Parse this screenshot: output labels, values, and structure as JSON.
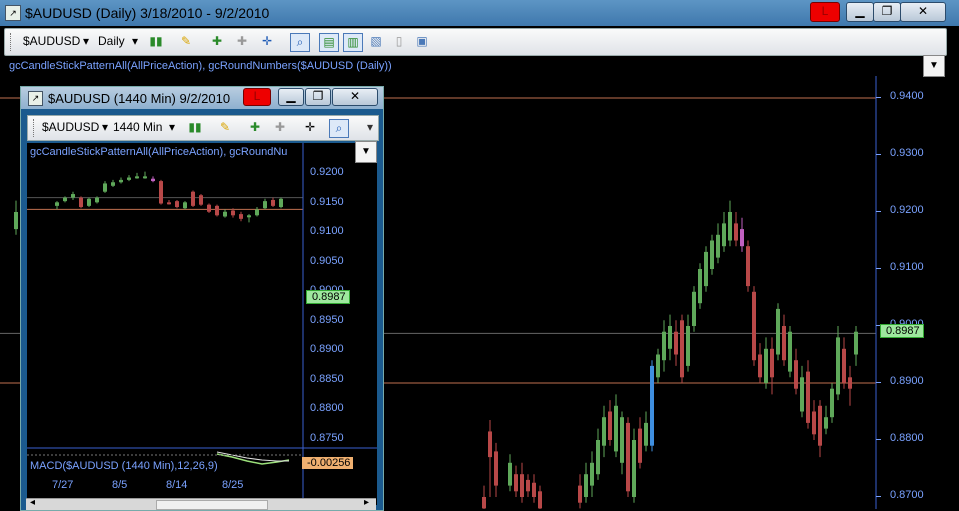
{
  "main_window": {
    "title": "$AUDUSD (Daily)  3/18/2010 - 9/2/2010",
    "controls": {
      "minimize": "▁",
      "restore": "❐",
      "close": "✕",
      "flag": "L"
    },
    "toolbar": {
      "symbol": "$AUDUSD",
      "interval": "Daily",
      "dropdown": "▾"
    },
    "study_line": "gcCandleStickPatternAll(AllPriceAction), gcRoundNumbers($AUDUSD (Daily))",
    "price_axis": [
      "0.9400",
      "0.9300",
      "0.9200",
      "0.9100",
      "0.9000",
      "0.8900",
      "0.8800",
      "0.8700"
    ],
    "last_price": "0.8987",
    "accent_colors": {
      "up": "#5fa85a",
      "down": "#b84848",
      "highlight": "#3f8fe0",
      "round_line": "#c07050",
      "axis": "#7aa2ff"
    }
  },
  "child_window": {
    "title": "$AUDUSD (1440 Min)  9/2/2010",
    "controls": {
      "minimize": "▁",
      "restore": "❐",
      "close": "✕",
      "flag": "L"
    },
    "toolbar": {
      "symbol": "$AUDUSD",
      "interval": "1440 Min",
      "dropdown": "▾"
    },
    "study_line": "gcCandleStickPatternAll(AllPriceAction), gcRoundNu",
    "price_axis": [
      "0.9200",
      "0.9150",
      "0.9100",
      "0.9050",
      "0.9000",
      "0.8950",
      "0.8900",
      "0.8850",
      "0.8800",
      "0.8750"
    ],
    "last_price": "0.8987",
    "osc_label": "MACD($AUDUSD (1440 Min),12,26,9)",
    "osc_value": "-0.00256",
    "dates": [
      "7/27",
      "8/5",
      "8/14",
      "8/25"
    ]
  }
}
